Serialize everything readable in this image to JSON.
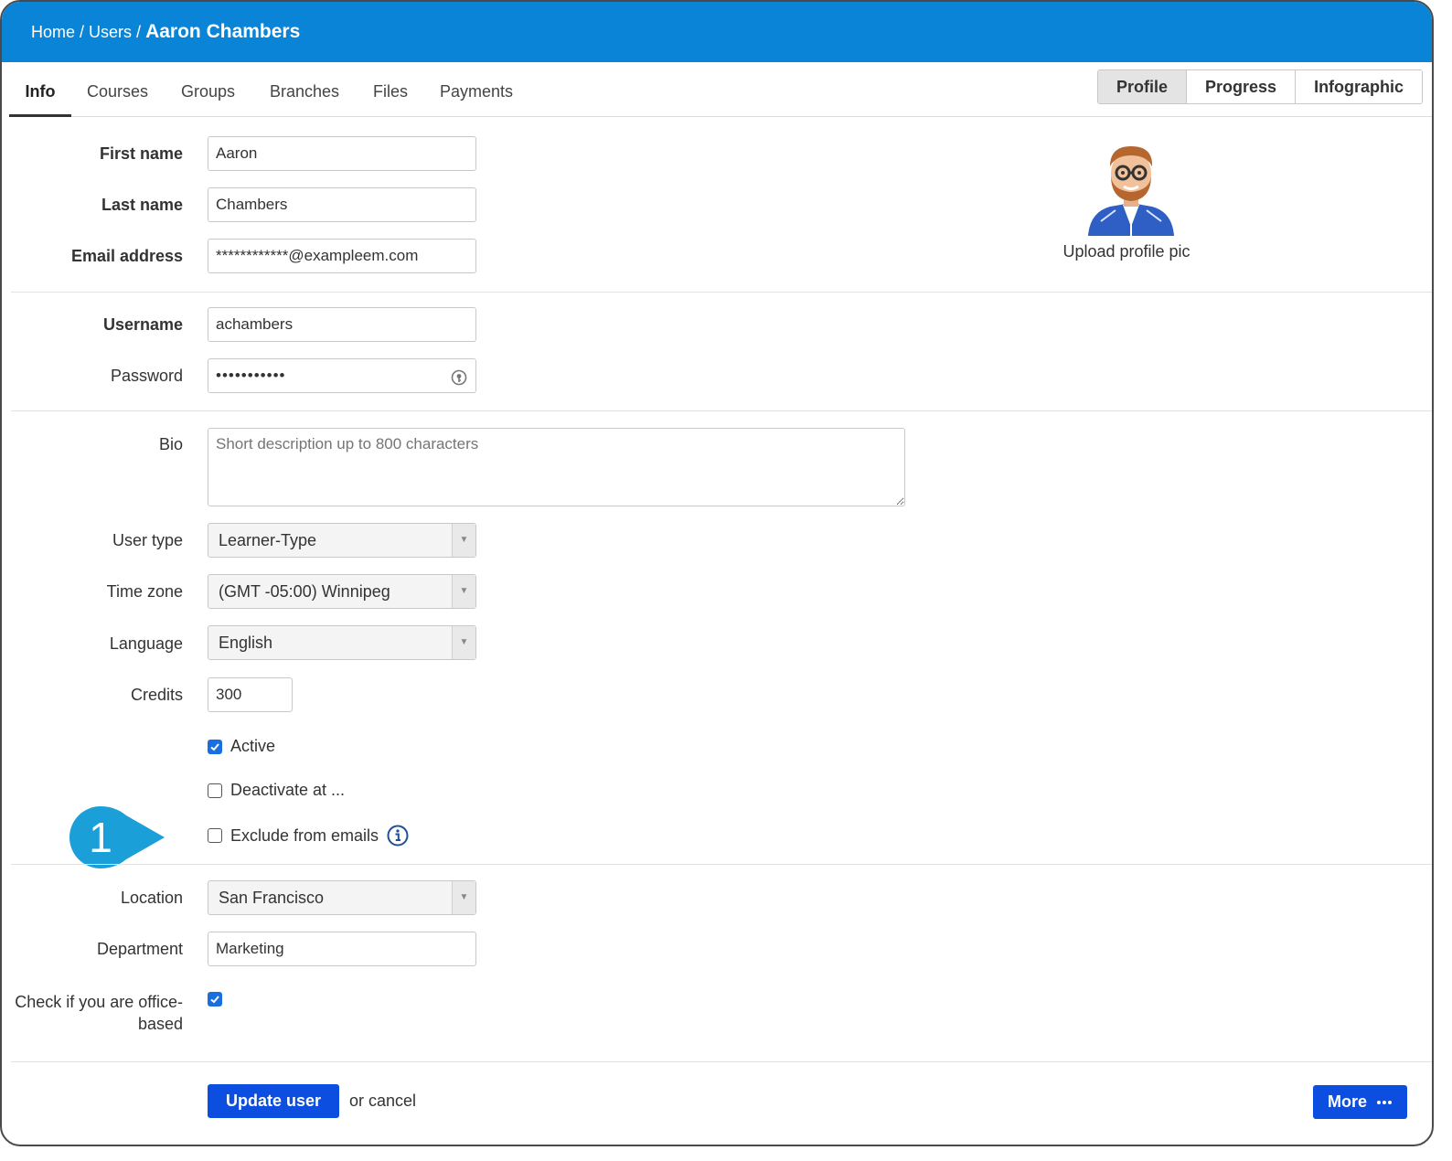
{
  "breadcrumb": {
    "home": "Home",
    "sep": "/",
    "users": "Users",
    "current": "Aaron Chambers"
  },
  "tabs": [
    "Info",
    "Courses",
    "Groups",
    "Branches",
    "Files",
    "Payments"
  ],
  "view_toggle": {
    "profile": "Profile",
    "progress": "Progress",
    "infographic": "Infographic"
  },
  "profile_pic": {
    "upload_label": "Upload profile pic"
  },
  "form": {
    "first_name": {
      "label": "First name",
      "value": "Aaron"
    },
    "last_name": {
      "label": "Last name",
      "value": "Chambers"
    },
    "email": {
      "label": "Email address",
      "value": "************@exampleem.com"
    },
    "username": {
      "label": "Username",
      "value": "achambers"
    },
    "password": {
      "label": "Password",
      "value": "•••••••••••"
    },
    "bio": {
      "label": "Bio",
      "placeholder": "Short description up to 800 characters"
    },
    "user_type": {
      "label": "User type",
      "value": "Learner-Type"
    },
    "time_zone": {
      "label": "Time zone",
      "value": "(GMT -05:00) Winnipeg"
    },
    "language": {
      "label": "Language",
      "value": "English"
    },
    "credits": {
      "label": "Credits",
      "value": "300"
    },
    "active": {
      "label": "Active",
      "checked": true
    },
    "deactivate": {
      "label": "Deactivate at ...",
      "checked": false
    },
    "exclude_emails": {
      "label": "Exclude from emails",
      "checked": false
    },
    "location": {
      "label": "Location",
      "value": "San Francisco"
    },
    "department": {
      "label": "Department",
      "value": "Marketing"
    },
    "office_based": {
      "label_line1": "Check if you are office-",
      "label_line2": "based",
      "checked": true
    }
  },
  "callout": {
    "number": "1",
    "color": "#1a9fd8"
  },
  "actions": {
    "update": "Update user",
    "cancel": "or cancel",
    "more": "More"
  },
  "colors": {
    "header": "#0a84d6",
    "primary_button": "#0b4ee0",
    "checkbox": "#1a6fe0"
  }
}
